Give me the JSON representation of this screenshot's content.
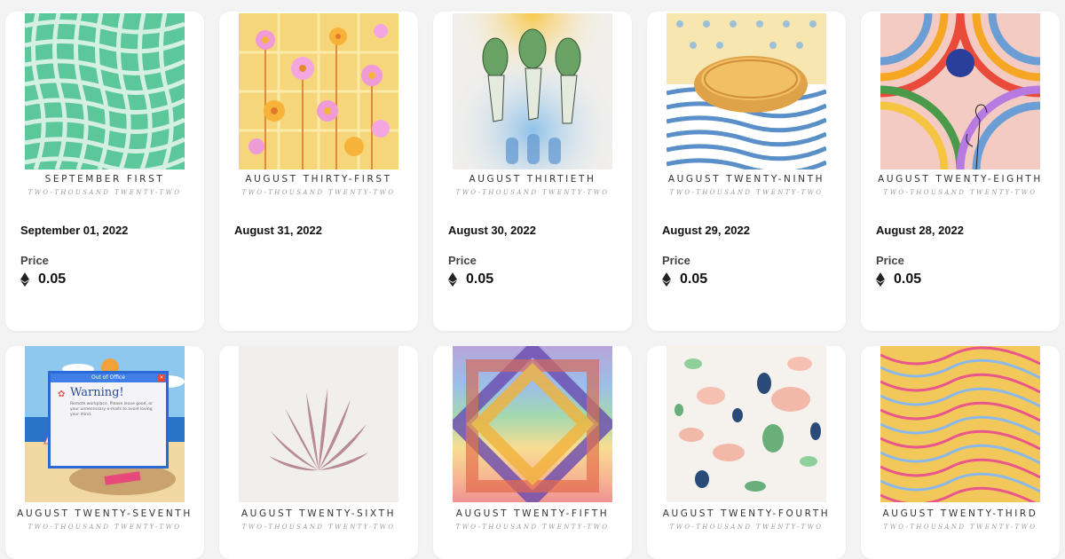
{
  "colors": {
    "page_bg": "#f3f3f4",
    "card_bg": "#ffffff",
    "text": "#111111"
  },
  "price_label": "Price",
  "currency_icon": "ethereum-icon",
  "row1": [
    {
      "art_title": "SEPTEMBER FIRST",
      "art_subtitle": "TWO-THOUSAND TWENTY-TWO",
      "date": "September 01, 2022",
      "price": "0.05",
      "show_price": true
    },
    {
      "art_title": "AUGUST THIRTY-FIRST",
      "art_subtitle": "TWO-THOUSAND TWENTY-TWO",
      "date": "August 31, 2022",
      "price": "",
      "show_price": false
    },
    {
      "art_title": "AUGUST THIRTIETH",
      "art_subtitle": "TWO-THOUSAND TWENTY-TWO",
      "date": "August 30, 2022",
      "price": "0.05",
      "show_price": true
    },
    {
      "art_title": "AUGUST TWENTY-NINTH",
      "art_subtitle": "TWO-THOUSAND TWENTY-TWO",
      "date": "August 29, 2022",
      "price": "0.05",
      "show_price": true
    },
    {
      "art_title": "AUGUST TWENTY-EIGHTH",
      "art_subtitle": "TWO-THOUSAND TWENTY-TWO",
      "date": "August 28, 2022",
      "price": "0.05",
      "show_price": true
    }
  ],
  "row2": [
    {
      "art_title": "AUGUST TWENTY-SEVENTH",
      "art_subtitle": "TWO-THOUSAND TWENTY-TWO",
      "popup": {
        "title": "Out of Office",
        "heading": "Warning!",
        "body": "Remote workplace. Please leave good, or your unnecessary e-mails to avoid loving your mind."
      }
    },
    {
      "art_title": "AUGUST TWENTY-SIXTH",
      "art_subtitle": "TWO-THOUSAND TWENTY-TWO"
    },
    {
      "art_title": "AUGUST TWENTY-FIFTH",
      "art_subtitle": "TWO-THOUSAND TWENTY-TWO"
    },
    {
      "art_title": "AUGUST TWENTY-FOURTH",
      "art_subtitle": "TWO-THOUSAND TWENTY-TWO"
    },
    {
      "art_title": "AUGUST TWENTY-THIRD",
      "art_subtitle": "TWO-THOUSAND TWENTY-TWO"
    }
  ]
}
